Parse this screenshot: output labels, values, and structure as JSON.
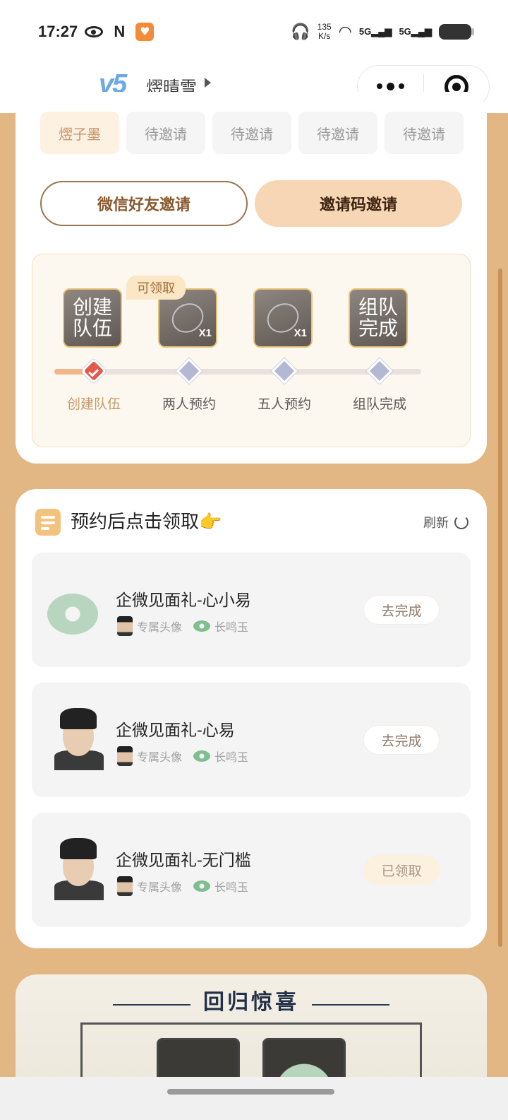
{
  "status_bar": {
    "time": "17:27",
    "net_speed_value": "135",
    "net_speed_unit": "K/s",
    "sim1": "5G",
    "sim2": "5G"
  },
  "header": {
    "vip_level": "v5",
    "username": "熤晴雪"
  },
  "team": {
    "members": [
      "熤子墨",
      "待邀请",
      "待邀请",
      "待邀请",
      "待邀请"
    ],
    "wechat_invite_label": "微信好友邀请",
    "code_invite_label": "邀请码邀请",
    "claimable_tag": "可领取",
    "steps": [
      {
        "tile_text": "创建\n队伍",
        "label": "创建队伍",
        "reward_qty": "",
        "done": true
      },
      {
        "tile_text": "",
        "label": "两人预约",
        "reward_qty": "X1",
        "done": false
      },
      {
        "tile_text": "",
        "label": "五人预约",
        "reward_qty": "X1",
        "done": false
      },
      {
        "tile_text": "组队\n完成",
        "label": "组队完成",
        "reward_qty": "",
        "done": false
      }
    ],
    "progress_fraction": 0.1
  },
  "rewards": {
    "title": "预约后点击领取👉",
    "refresh_label": "刷新",
    "tasks": [
      {
        "name": "企微见面礼-心小易",
        "item1": "专属头像",
        "item2": "长鸣玉",
        "button": "去完成",
        "state": "todo"
      },
      {
        "name": "企微见面礼-心易",
        "item1": "专属头像",
        "item2": "长鸣玉",
        "button": "去完成",
        "state": "todo"
      },
      {
        "name": "企微见面礼-无门槛",
        "item1": "专属头像",
        "item2": "长鸣玉",
        "button": "已领取",
        "state": "claimed"
      }
    ]
  },
  "return_section": {
    "title": "回归惊喜"
  },
  "colors": {
    "page_bg": "#e2b784",
    "accent": "#f6d6b5",
    "claim_tag": "#fbe6c6",
    "done_node": "#e25a4a"
  }
}
